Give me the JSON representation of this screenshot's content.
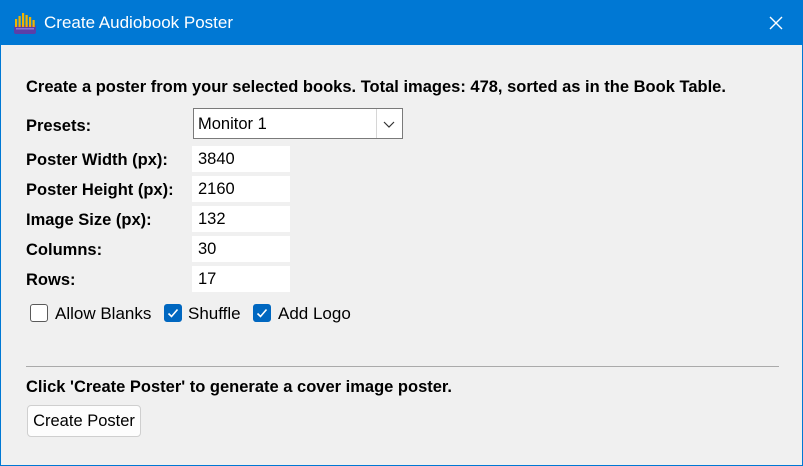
{
  "window": {
    "title": "Create Audiobook Poster"
  },
  "description": "Create a poster from your selected books. Total images: 478, sorted as in the Book Table.",
  "form": {
    "presets": {
      "label": "Presets:",
      "value": "Monitor 1"
    },
    "poster_width": {
      "label": "Poster Width (px):",
      "value": "3840"
    },
    "poster_height": {
      "label": "Poster Height (px):",
      "value": "2160"
    },
    "image_size": {
      "label": "Image Size (px):",
      "value": "132"
    },
    "columns": {
      "label": "Columns:",
      "value": "30"
    },
    "rows": {
      "label": "Rows:",
      "value": "17"
    }
  },
  "options": {
    "allow_blanks": {
      "label": "Allow Blanks",
      "checked": false
    },
    "shuffle": {
      "label": "Shuffle",
      "checked": true
    },
    "add_logo": {
      "label": "Add Logo",
      "checked": true
    }
  },
  "hint": "Click 'Create Poster' to generate a cover image poster.",
  "actions": {
    "create_label": "Create Poster"
  },
  "colors": {
    "titlebar": "#0078d4",
    "checkbox_checked": "#0067c0",
    "background": "#f0f0f0"
  },
  "icons": {
    "app": "audiobook-bars-icon",
    "close": "close-icon",
    "dropdown": "chevron-down-icon",
    "check": "check-icon"
  }
}
